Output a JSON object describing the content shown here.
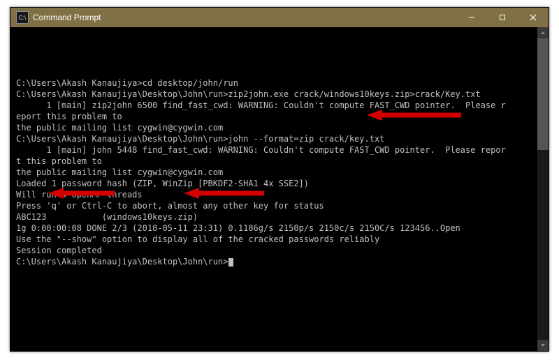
{
  "titlebar": {
    "icon_label": "C:\\",
    "title": "Command Prompt"
  },
  "terminal": {
    "lines": [
      "C:\\Users\\Akash Kanaujiya>cd desktop/john/run",
      "",
      "C:\\Users\\Akash Kanaujiya\\Desktop\\John\\run>zip2john.exe crack/windows10keys.zip>crack/Key.txt",
      "      1 [main] zip2john 6500 find_fast_cwd: WARNING: Couldn't compute FAST_CWD pointer.  Please r",
      "eport this problem to",
      "the public mailing list cygwin@cygwin.com",
      "",
      "C:\\Users\\Akash Kanaujiya\\Desktop\\John\\run>john --format=zip crack/key.txt",
      "      1 [main] john 5448 find_fast_cwd: WARNING: Couldn't compute FAST_CWD pointer.  Please repor",
      "t this problem to",
      "the public mailing list cygwin@cygwin.com",
      "Loaded 1 password hash (ZIP, WinZip [PBKDF2-SHA1 4x SSE2])",
      "Will run 4 OpenMP threads",
      "Press 'q' or Ctrl-C to abort, almost any other key for status",
      "ABC123           (windows10keys.zip)",
      "1g 0:00:00:08 DONE 2/3 (2018-05-11 23:31) 0.1186g/s 2150p/s 2150c/s 2150C/s 123456..Open",
      "Use the \"--show\" option to display all of the cracked passwords reliably",
      "Session completed",
      "",
      "C:\\Users\\Akash Kanaujiya\\Desktop\\John\\run>"
    ]
  }
}
